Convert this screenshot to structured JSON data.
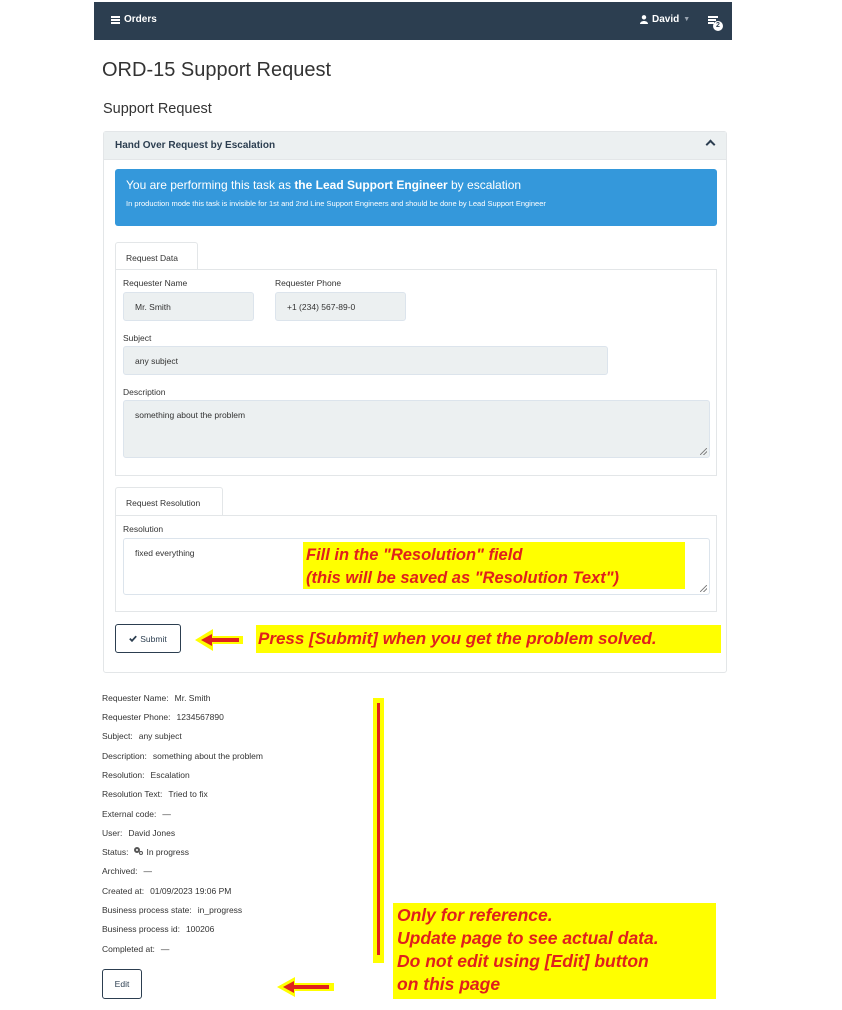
{
  "navbar": {
    "brand": "Orders",
    "user": "David",
    "notification_count": "2"
  },
  "page": {
    "title": "ORD-15 Support Request",
    "subtitle": "Support Request"
  },
  "panel": {
    "heading": "Hand Over Request by Escalation",
    "alert": {
      "prefix": "You are performing this task as ",
      "role": "the Lead Support Engineer",
      "suffix": " by escalation",
      "note": "In production mode this task is invisible for 1st and 2nd Line Support Engineers and should be done by Lead Support Engineer"
    },
    "request_data": {
      "tab": "Request Data",
      "requester_name_label": "Requester Name",
      "requester_name": "Mr. Smith",
      "requester_phone_label": "Requester Phone",
      "requester_phone": "+1 (234) 567-89-0",
      "subject_label": "Subject",
      "subject": "any subject",
      "description_label": "Description",
      "description": "something about the problem"
    },
    "request_resolution": {
      "tab": "Request Resolution",
      "resolution_label": "Resolution",
      "resolution": "fixed everything"
    },
    "submit_label": "Submit"
  },
  "annotations": {
    "fill_line1": "Fill in the \"Resolution\" field",
    "fill_line2": " (this will be saved as \"Resolution Text\")",
    "press": "Press [Submit] when you get the problem solved.",
    "ref_line1": "Only for reference.",
    "ref_line2": "Update page to see actual data.",
    "ref_line3": "Do not edit using [Edit] button",
    "ref_line4": "on  this page"
  },
  "details": [
    {
      "key": "Requester Name:",
      "value": "Mr. Smith"
    },
    {
      "key": "Requester Phone:",
      "value": "1234567890"
    },
    {
      "key": "Subject:",
      "value": "any subject"
    },
    {
      "key": "Description:",
      "value": "something about the problem"
    },
    {
      "key": "Resolution:",
      "value": "Escalation"
    },
    {
      "key": "Resolution Text:",
      "value": "Tried to fix"
    },
    {
      "key": "External code:",
      "value": "—"
    },
    {
      "key": "User:",
      "value": "David Jones"
    },
    {
      "key": "Status:",
      "value": "In progress"
    },
    {
      "key": "Archived:",
      "value": "—"
    },
    {
      "key": "Created at:",
      "value": "01/09/2023 19:06 PM"
    },
    {
      "key": "Business process state:",
      "value": "in_progress"
    },
    {
      "key": "Business process id:",
      "value": "100206"
    },
    {
      "key": "Completed at:",
      "value": "—"
    }
  ],
  "edit_label": "Edit",
  "colors": {
    "navbar": "#2c3e50",
    "alert": "#3498db",
    "highlight": "#ffff00",
    "annotation_text": "#e0201c"
  },
  "icons": {
    "brand": "list-icon",
    "user": "user-icon",
    "notifications": "notification-list-icon",
    "collapse": "chevron-up-icon",
    "submit": "check-icon",
    "status": "gears-icon"
  }
}
